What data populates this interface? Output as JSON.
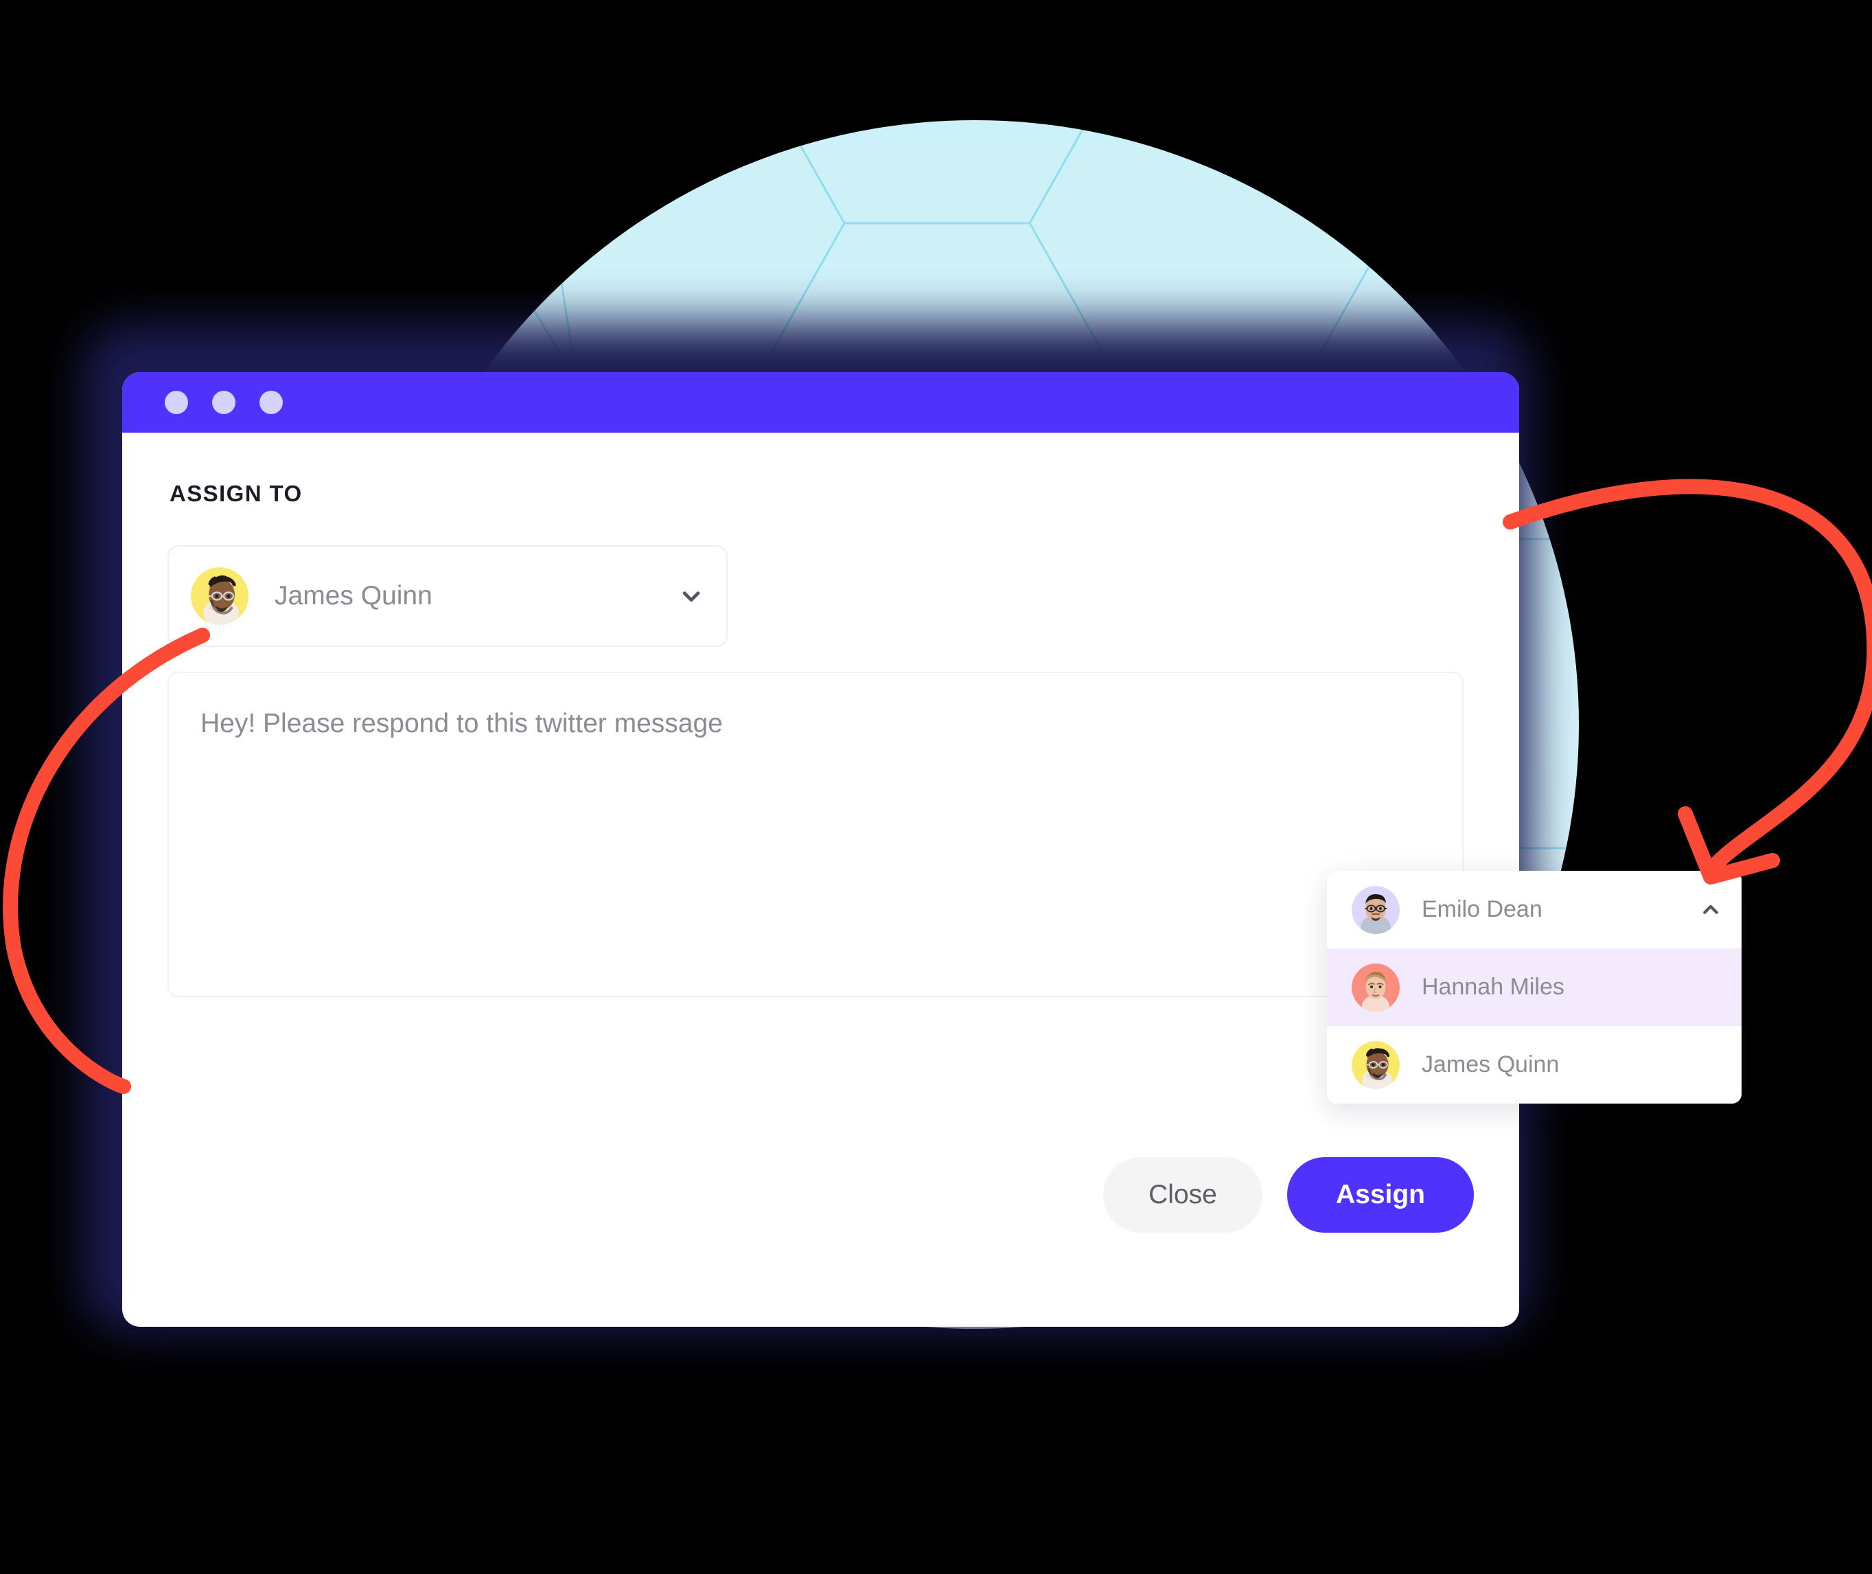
{
  "window": {
    "titlebar_dots": [
      "dot-1",
      "dot-2",
      "dot-3"
    ]
  },
  "form": {
    "section_label": "ASSIGN TO",
    "assignee_select": {
      "selected_value": "James Quinn",
      "chevron_icon": "chevron-down-icon",
      "avatar_icon": "avatar-james-quinn",
      "avatar_bg": "#fbe96b"
    },
    "message": {
      "placeholder": "Hey! Please respond to this twitter message",
      "value": ""
    }
  },
  "actions": {
    "close_label": "Close",
    "assign_label": "Assign"
  },
  "dropdown": {
    "chevron_icon": "chevron-up-icon",
    "options": [
      {
        "name": "Emilo Dean",
        "avatar_bg": "#ded7fb",
        "selected": false
      },
      {
        "name": "Hannah Miles",
        "avatar_bg": "#fb8d7e",
        "selected": true
      },
      {
        "name": "James Quinn",
        "avatar_bg": "#fbe96b",
        "selected": false
      }
    ]
  },
  "colors": {
    "accent_blue": "#4f33fd",
    "titlebar_dot": "#d7d2fb",
    "frame_navy": "#1b1b52",
    "highlight_row": "#f3ebfd",
    "annotation_red": "#fb4b36",
    "backdrop_cyan": "#cdf1f8",
    "pattern_line": "#8fddee",
    "text_muted": "#8b8b94",
    "text_dark": "#1c1c28"
  }
}
